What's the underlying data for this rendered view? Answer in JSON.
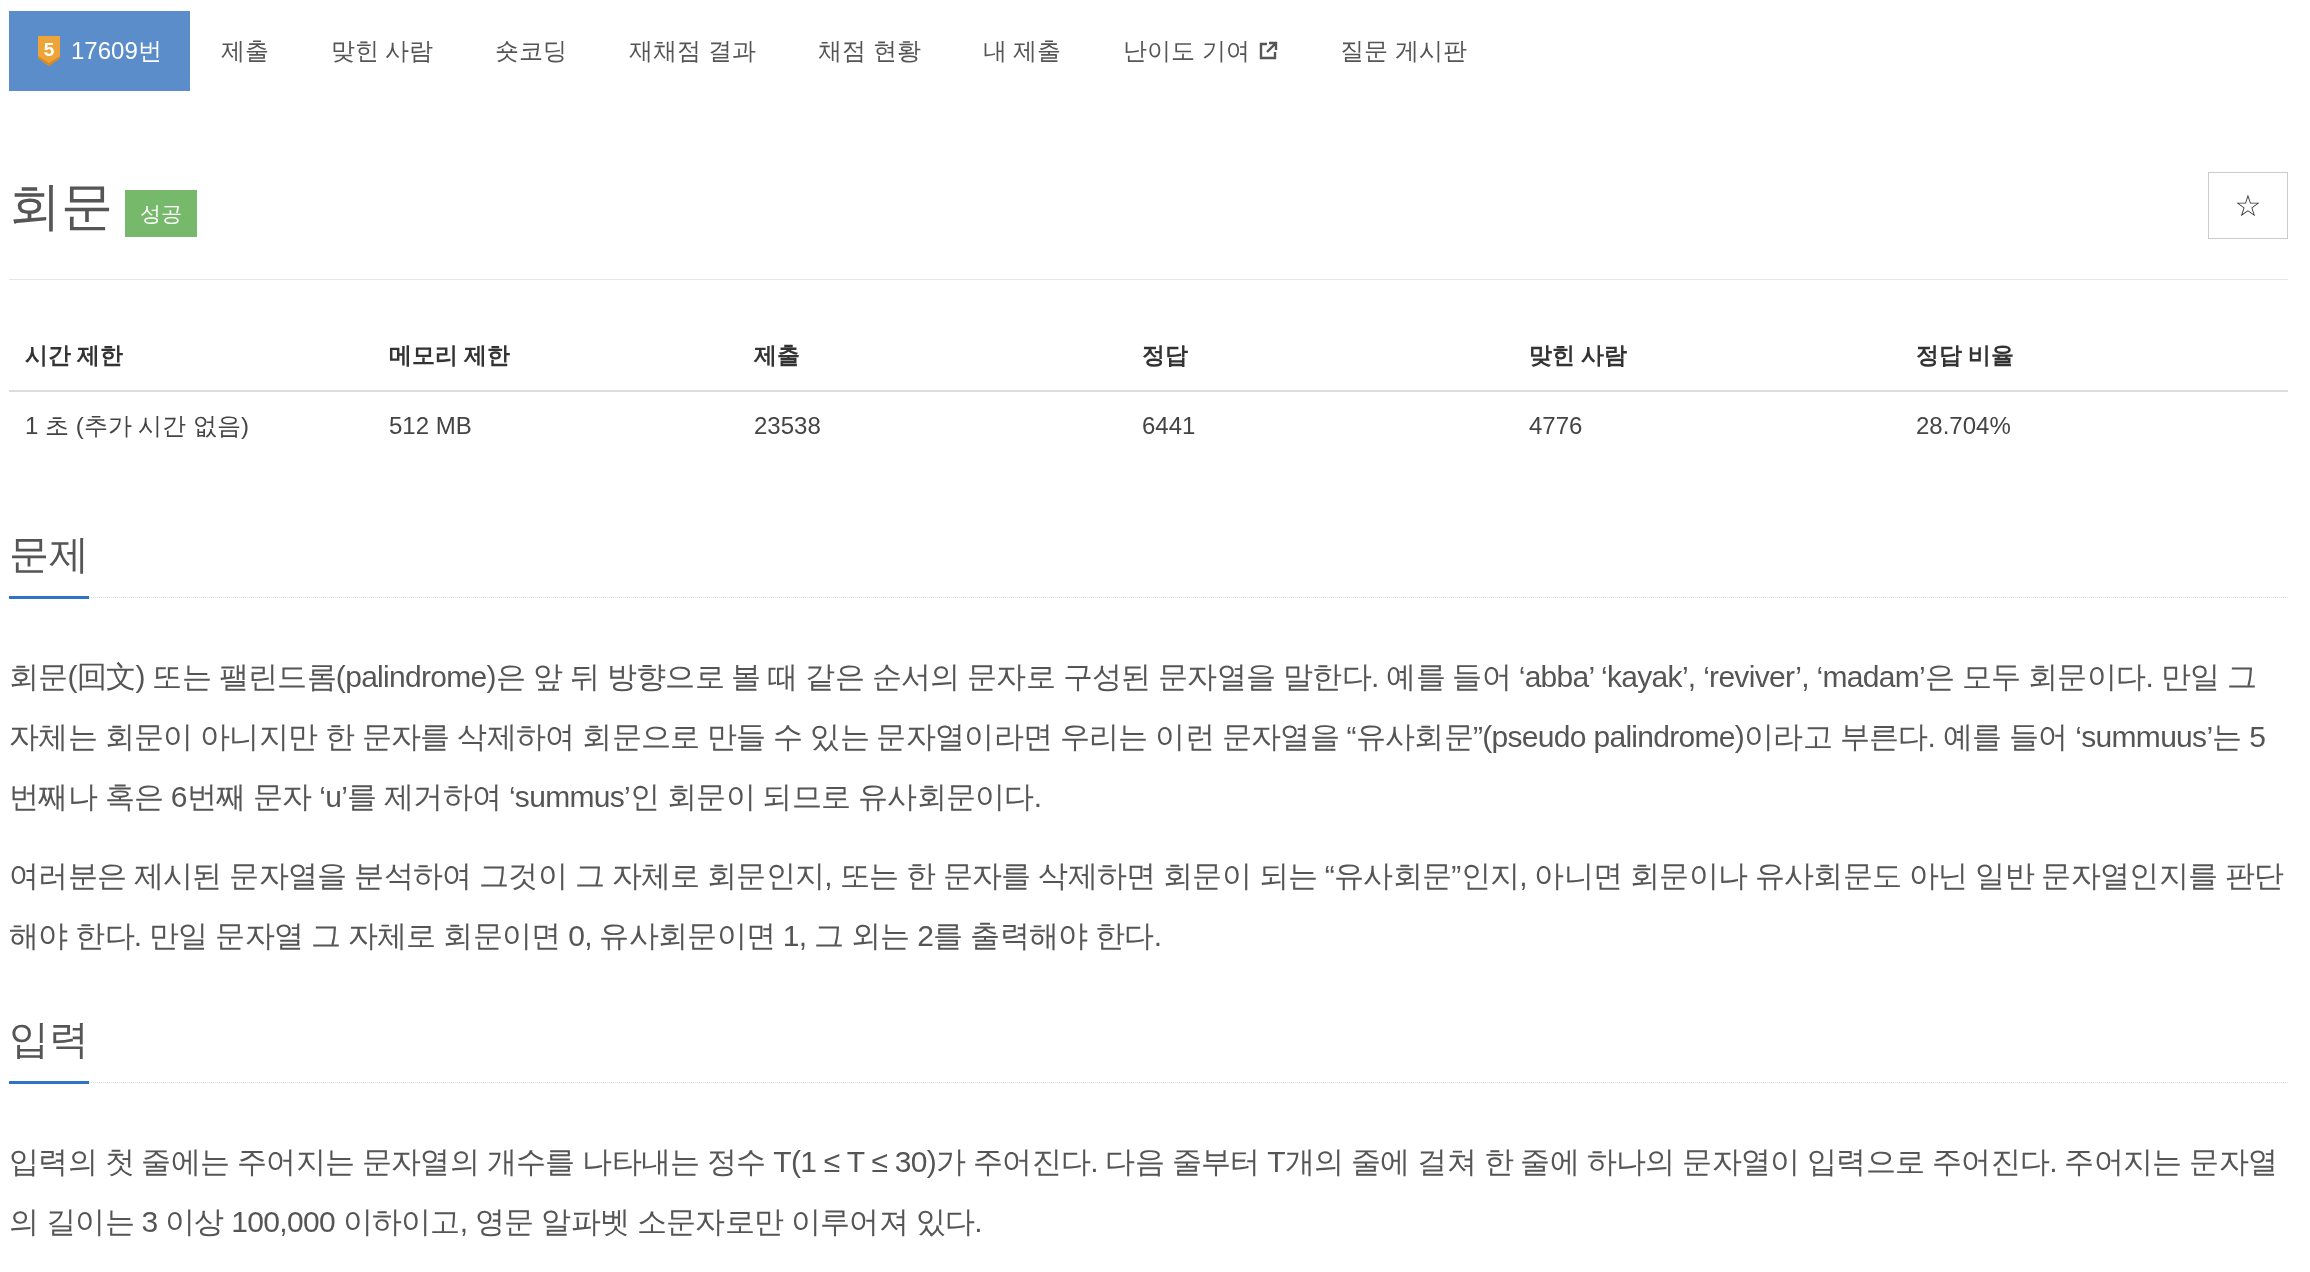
{
  "nav": {
    "tabs": [
      {
        "label": "17609번",
        "selected": true,
        "tier": "5"
      },
      {
        "label": "제출",
        "selected": false
      },
      {
        "label": "맞힌 사람",
        "selected": false
      },
      {
        "label": "숏코딩",
        "selected": false
      },
      {
        "label": "재채점 결과",
        "selected": false
      },
      {
        "label": "채점 현황",
        "selected": false
      },
      {
        "label": "내 제출",
        "selected": false
      },
      {
        "label": "난이도 기여",
        "selected": false,
        "external": true
      },
      {
        "label": "질문 게시판",
        "selected": false
      }
    ]
  },
  "problem": {
    "title": "회문",
    "status_badge": "성공",
    "star_button": "☆"
  },
  "info_table": {
    "columns": [
      "시간 제한",
      "메모리 제한",
      "제출",
      "정답",
      "맞힌 사람",
      "정답 비율"
    ],
    "rows": [
      [
        "1 초 (추가 시간 없음)",
        "512 MB",
        "23538",
        "6441",
        "4776",
        "28.704%"
      ]
    ]
  },
  "sections": [
    {
      "heading": "문제",
      "paragraphs": [
        "회문(回文) 또는 팰린드롬(palindrome)은 앞 뒤 방향으로 볼 때 같은 순서의 문자로 구성된 문자열을 말한다. 예를 들어 ‘abba’ ‘kayak’, ‘reviver’, ‘madam’은 모두 회문이다. 만일 그 자체는 회문이 아니지만 한 문자를 삭제하여 회문으로 만들 수 있는 문자열이라면 우리는 이런 문자열을 “유사회문”(pseudo palindrome)이라고 부른다. 예를 들어 ‘summuus’는 5번째나 혹은 6번째 문자 ‘u’를 제거하여 ‘summus’인 회문이 되므로 유사회문이다.",
        "여러분은 제시된 문자열을 분석하여 그것이 그 자체로 회문인지, 또는 한 문자를 삭제하면 회문이 되는 “유사회문”인지, 아니면 회문이나 유사회문도 아닌 일반 문자열인지를 판단해야 한다. 만일 문자열 그 자체로 회문이면 0, 유사회문이면 1, 그 외는 2를 출력해야 한다."
      ]
    },
    {
      "heading": "입력",
      "paragraphs": [
        "입력의 첫 줄에는 주어지는 문자열의 개수를 나타내는 정수 T(1 ≤ T ≤ 30)가 주어진다. 다음 줄부터 T개의 줄에 걸쳐 한 줄에 하나의 문자열이 입력으로 주어진다. 주어지는 문자열의 길이는 3 이상 100,000 이하이고, 영문 알파벳 소문자로만 이루어져 있다."
      ]
    }
  ]
}
